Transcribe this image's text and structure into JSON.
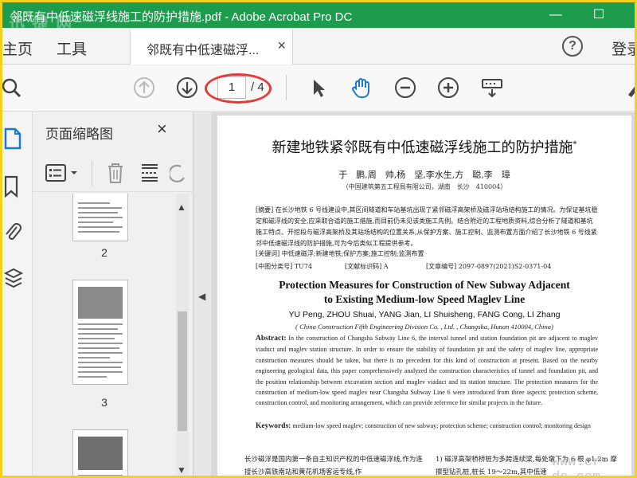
{
  "window": {
    "title": "邻既有中低速磁浮线施工的防护措施.pdf - Adobe Acrobat Pro DC",
    "watermark_top": "迅 捷 网",
    "minimize": "—",
    "maximize": "☐"
  },
  "tabs": {
    "home": "主页",
    "tools": "工具",
    "doc_tab": "邻既有中低速磁浮...",
    "doc_close": "×",
    "help": "?",
    "login": "登录"
  },
  "toolbar": {
    "current_page": "1",
    "total_pages": "/ 4"
  },
  "thumbnails": {
    "title": "页面缩略图",
    "close": "×",
    "pages": [
      "2",
      "3"
    ]
  },
  "document": {
    "title_cn": "新建地铁紧邻既有中低速磁浮线施工的防护措施",
    "title_mark": "*",
    "authors_cn": "于　鹏,周　帅,杨　坚,李水生,方　聪,李　璋",
    "affil_cn": "（中国建筑第五工程局有限公司，湖南　长沙　410004）",
    "abstract_cn": "[摘要] 在长沙地铁 6 号线建设中,其区间隧道和车站基坑出现了紧邻磁浮高架桥及磁浮站场结构施工的情况。为保证基坑稳定和磁浮线的安全,应采取合适的施工措施,而目前仍未见该类施工先例。结合附近的工程地质资料,综合分析了隧道和基坑施工特点、开挖段与磁浮高架桥及其站场结构的位置关系,从保护方案、施工控制、监测布置方面介绍了长沙地铁 6 号线紧邻中低速磁浮线的防护措施,可为今后类似工程提供参考。",
    "keywords_cn": "[关键词] 中低速磁浮;新建地铁;保护方案;施工控制;监测布置",
    "cls_num": "[中图分类号] TU74",
    "cls_code": "[文献标识码] A",
    "cls_id": "[文章编号] 2097-0897(2021)S2-0371-04",
    "title_en_1": "Protection Measures for Construction of New Subway Adjacent",
    "title_en_2": "to Existing Medium-low Speed Maglev Line",
    "authors_en": "YU Peng, ZHOU Shuai, YANG Jian, LI Shuisheng, FANG Cong, LI Zhang",
    "affil_en": "( China Construction Fifth Engineering Division Co. , Ltd. , Changsha, Hunan   410004, China)",
    "abstract_en_label": "Abstract:",
    "abstract_en": "In the construction of Changsha Subway Line 6, the interval tunnel and station foundation pit are adjacent to maglev viaduct and maglev station structure. In order to ensure the stability of foundation pit and the safety of maglev line, appropriate construction measures should be taken, but there is no precedent for this kind of construction at present. Based on the nearby engineering geological data, this paper comprehensively analyzed the construction characteristics of tunnel and foundation pit, and the position relationship between excavation section and maglev viaduct and its station structure. The protection measures for the construction of medium-low speed maglev near Changsha Subway Line 6 were introduced from three aspects: protection scheme, construction control, and monitoring arrangement, which can provide reference for similar projects in the future.",
    "keywords_en_label": "Keywords:",
    "keywords_en": "medium-low speed maglev; construction of new subway; protection scheme; construction control; monitoring design",
    "body_left": "长沙磁浮是国内第一条自主知识产权的中低速磁浮线,作为连接长沙高铁南站和黄花机场客运专线,作",
    "body_right": "1) 磁浮高架桥桥桩为多跨连续梁,每处墩下为 6 根 φ1.2m 摩擦型钻孔桩,桩长 19～22m,其中低速",
    "watermark_bottom": "www.cr-dc.com"
  }
}
